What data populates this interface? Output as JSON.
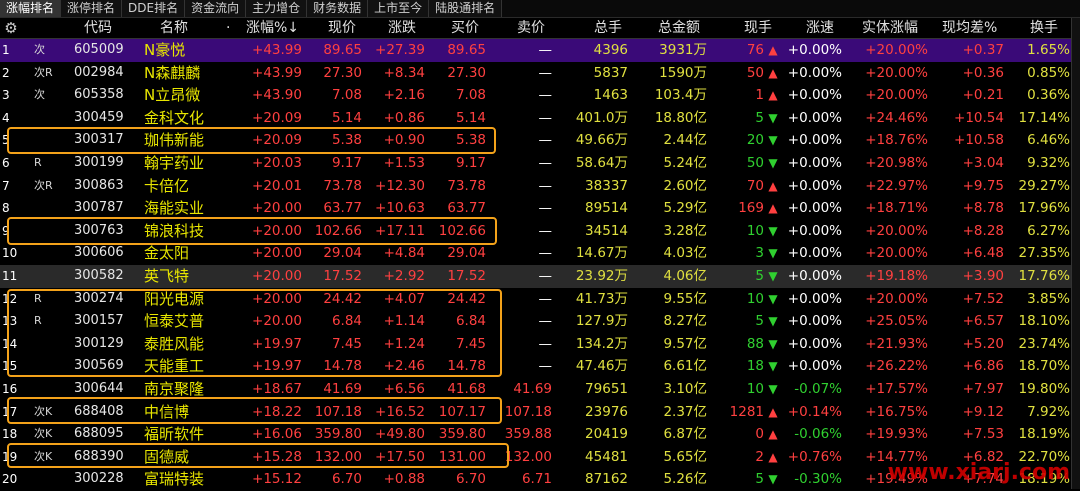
{
  "tabs": [
    {
      "label": "涨幅排名",
      "active": true
    },
    {
      "label": "涨停排名",
      "active": false
    },
    {
      "label": "DDE排名",
      "active": false
    },
    {
      "label": "资金流向",
      "active": false
    },
    {
      "label": "主力增仓",
      "active": false
    },
    {
      "label": "财务数据",
      "active": false
    },
    {
      "label": "上市至今",
      "active": false
    },
    {
      "label": "陆股通排名",
      "active": false
    }
  ],
  "columns": {
    "code": "代码",
    "name": "名称",
    "dot": "·",
    "pct": "涨幅%↓",
    "price": "现价",
    "change": "涨跌",
    "bid": "买价",
    "ask": "卖价",
    "volume": "总手",
    "amount": "总金额",
    "cur_vol": "现手",
    "speed": "涨速",
    "entity": "实体涨幅",
    "avg_diff": "现均差%",
    "turnover": "换手"
  },
  "rows": [
    {
      "idx": "1",
      "flag": "次",
      "code": "605009",
      "name": "N豪悦",
      "pct": "+43.99",
      "price": "89.65",
      "chg": "+27.39",
      "bid": "89.65",
      "ask": "—",
      "vol": "4396",
      "amt": "3931万",
      "cur": "76",
      "dir": "up",
      "spd": "+0.00%",
      "ent": "+20.00%",
      "diff": "+0.37",
      "turn": "1.65%"
    },
    {
      "idx": "2",
      "flag": "次R",
      "code": "002984",
      "name": "N森麒麟",
      "pct": "+43.99",
      "price": "27.30",
      "chg": "+8.34",
      "bid": "27.30",
      "ask": "—",
      "vol": "5837",
      "amt": "1590万",
      "cur": "50",
      "dir": "up",
      "spd": "+0.00%",
      "ent": "+20.00%",
      "diff": "+0.36",
      "turn": "0.85%"
    },
    {
      "idx": "3",
      "flag": "次",
      "code": "605358",
      "name": "N立昂微",
      "pct": "+43.90",
      "price": "7.08",
      "chg": "+2.16",
      "bid": "7.08",
      "ask": "—",
      "vol": "1463",
      "amt": "103.4万",
      "cur": "1",
      "dir": "up",
      "spd": "+0.00%",
      "ent": "+20.00%",
      "diff": "+0.21",
      "turn": "0.36%"
    },
    {
      "idx": "4",
      "flag": "",
      "code": "300459",
      "name": "金科文化",
      "pct": "+20.09",
      "price": "5.14",
      "chg": "+0.86",
      "bid": "5.14",
      "ask": "—",
      "vol": "401.0万",
      "amt": "18.80亿",
      "cur": "5",
      "dir": "down",
      "spd": "+0.00%",
      "ent": "+24.46%",
      "diff": "+10.54",
      "turn": "17.14%"
    },
    {
      "idx": "5",
      "flag": "",
      "code": "300317",
      "name": "珈伟新能",
      "pct": "+20.09",
      "price": "5.38",
      "chg": "+0.90",
      "bid": "5.38",
      "ask": "—",
      "vol": "49.66万",
      "amt": "2.44亿",
      "cur": "20",
      "dir": "down",
      "spd": "+0.00%",
      "ent": "+18.76%",
      "diff": "+10.58",
      "turn": "6.46%"
    },
    {
      "idx": "6",
      "flag": "R",
      "code": "300199",
      "name": "翰宇药业",
      "pct": "+20.03",
      "price": "9.17",
      "chg": "+1.53",
      "bid": "9.17",
      "ask": "—",
      "vol": "58.64万",
      "amt": "5.24亿",
      "cur": "50",
      "dir": "down",
      "spd": "+0.00%",
      "ent": "+20.98%",
      "diff": "+3.04",
      "turn": "9.32%"
    },
    {
      "idx": "7",
      "flag": "次R",
      "code": "300863",
      "name": "卡倍亿",
      "pct": "+20.01",
      "price": "73.78",
      "chg": "+12.30",
      "bid": "73.78",
      "ask": "—",
      "vol": "38337",
      "amt": "2.60亿",
      "cur": "70",
      "dir": "up",
      "spd": "+0.00%",
      "ent": "+22.97%",
      "diff": "+9.75",
      "turn": "29.27%"
    },
    {
      "idx": "8",
      "flag": "",
      "code": "300787",
      "name": "海能实业",
      "pct": "+20.00",
      "price": "63.77",
      "chg": "+10.63",
      "bid": "63.77",
      "ask": "—",
      "vol": "89514",
      "amt": "5.29亿",
      "cur": "169",
      "dir": "up",
      "spd": "+0.00%",
      "ent": "+18.71%",
      "diff": "+8.78",
      "turn": "17.96%"
    },
    {
      "idx": "9",
      "flag": "",
      "code": "300763",
      "name": "锦浪科技",
      "pct": "+20.00",
      "price": "102.66",
      "chg": "+17.11",
      "bid": "102.66",
      "ask": "—",
      "vol": "34514",
      "amt": "3.28亿",
      "cur": "10",
      "dir": "down",
      "spd": "+0.00%",
      "ent": "+20.00%",
      "diff": "+8.28",
      "turn": "6.27%"
    },
    {
      "idx": "10",
      "flag": "",
      "code": "300606",
      "name": "金太阳",
      "pct": "+20.00",
      "price": "29.04",
      "chg": "+4.84",
      "bid": "29.04",
      "ask": "—",
      "vol": "14.67万",
      "amt": "4.03亿",
      "cur": "3",
      "dir": "down",
      "spd": "+0.00%",
      "ent": "+20.00%",
      "diff": "+6.48",
      "turn": "27.35%"
    },
    {
      "idx": "11",
      "flag": "",
      "code": "300582",
      "name": "英飞特",
      "pct": "+20.00",
      "price": "17.52",
      "chg": "+2.92",
      "bid": "17.52",
      "ask": "—",
      "vol": "23.92万",
      "amt": "4.06亿",
      "cur": "5",
      "dir": "down",
      "spd": "+0.00%",
      "ent": "+19.18%",
      "diff": "+3.90",
      "turn": "17.76%"
    },
    {
      "idx": "12",
      "flag": "R",
      "code": "300274",
      "name": "阳光电源",
      "pct": "+20.00",
      "price": "24.42",
      "chg": "+4.07",
      "bid": "24.42",
      "ask": "—",
      "vol": "41.73万",
      "amt": "9.55亿",
      "cur": "10",
      "dir": "down",
      "spd": "+0.00%",
      "ent": "+20.00%",
      "diff": "+7.52",
      "turn": "3.85%"
    },
    {
      "idx": "13",
      "flag": "R",
      "code": "300157",
      "name": "恒泰艾普",
      "pct": "+20.00",
      "price": "6.84",
      "chg": "+1.14",
      "bid": "6.84",
      "ask": "—",
      "vol": "127.9万",
      "amt": "8.27亿",
      "cur": "5",
      "dir": "down",
      "spd": "+0.00%",
      "ent": "+25.05%",
      "diff": "+6.57",
      "turn": "18.10%"
    },
    {
      "idx": "14",
      "flag": "",
      "code": "300129",
      "name": "泰胜风能",
      "pct": "+19.97",
      "price": "7.45",
      "chg": "+1.24",
      "bid": "7.45",
      "ask": "—",
      "vol": "134.2万",
      "amt": "9.57亿",
      "cur": "88",
      "dir": "down",
      "spd": "+0.00%",
      "ent": "+21.93%",
      "diff": "+5.20",
      "turn": "23.74%"
    },
    {
      "idx": "15",
      "flag": "",
      "code": "300569",
      "name": "天能重工",
      "pct": "+19.97",
      "price": "14.78",
      "chg": "+2.46",
      "bid": "14.78",
      "ask": "—",
      "vol": "47.46万",
      "amt": "6.61亿",
      "cur": "18",
      "dir": "down",
      "spd": "+0.00%",
      "ent": "+26.22%",
      "diff": "+6.86",
      "turn": "18.70%"
    },
    {
      "idx": "16",
      "flag": "",
      "code": "300644",
      "name": "南京聚隆",
      "pct": "+18.67",
      "price": "41.69",
      "chg": "+6.56",
      "bid": "41.68",
      "ask": "41.69",
      "vol": "79651",
      "amt": "3.10亿",
      "cur": "10",
      "dir": "down",
      "spd": "-0.07%",
      "ent": "+17.57%",
      "diff": "+7.97",
      "turn": "19.80%"
    },
    {
      "idx": "17",
      "flag": "次K",
      "code": "688408",
      "name": "中信博",
      "pct": "+18.22",
      "price": "107.18",
      "chg": "+16.52",
      "bid": "107.17",
      "ask": "107.18",
      "vol": "23976",
      "amt": "2.37亿",
      "cur": "1281",
      "dir": "up",
      "spd": "+0.14%",
      "ent": "+16.75%",
      "diff": "+9.12",
      "turn": "7.92%"
    },
    {
      "idx": "18",
      "flag": "次K",
      "code": "688095",
      "name": "福昕软件",
      "pct": "+16.06",
      "price": "359.80",
      "chg": "+49.80",
      "bid": "359.80",
      "ask": "359.88",
      "vol": "20419",
      "amt": "6.87亿",
      "cur": "0",
      "dir": "up",
      "spd": "-0.06%",
      "ent": "+19.93%",
      "diff": "+7.53",
      "turn": "18.19%"
    },
    {
      "idx": "19",
      "flag": "次K",
      "code": "688390",
      "name": "固德威",
      "pct": "+15.28",
      "price": "132.00",
      "chg": "+17.50",
      "bid": "131.00",
      "ask": "132.00",
      "vol": "45481",
      "amt": "5.65亿",
      "cur": "2",
      "dir": "up",
      "spd": "+0.76%",
      "ent": "+14.77%",
      "diff": "+6.82",
      "turn": "22.70%"
    },
    {
      "idx": "20",
      "flag": "",
      "code": "300228",
      "name": "富瑞特装",
      "pct": "+15.12",
      "price": "6.70",
      "chg": "+0.88",
      "bid": "6.70",
      "ask": "6.71",
      "vol": "87162",
      "amt": "5.26亿",
      "cur": "5",
      "dir": "down",
      "spd": "-0.30%",
      "ent": "+19.49%",
      "diff": "+7.74",
      "turn": "18.19%"
    }
  ],
  "watermark": "www.xiarj.com",
  "colors": {
    "up": "#ff4040",
    "down": "#30d030",
    "selected": "#3a0a78",
    "highlight_box": "#f3a21a",
    "name": "#e8e600"
  }
}
